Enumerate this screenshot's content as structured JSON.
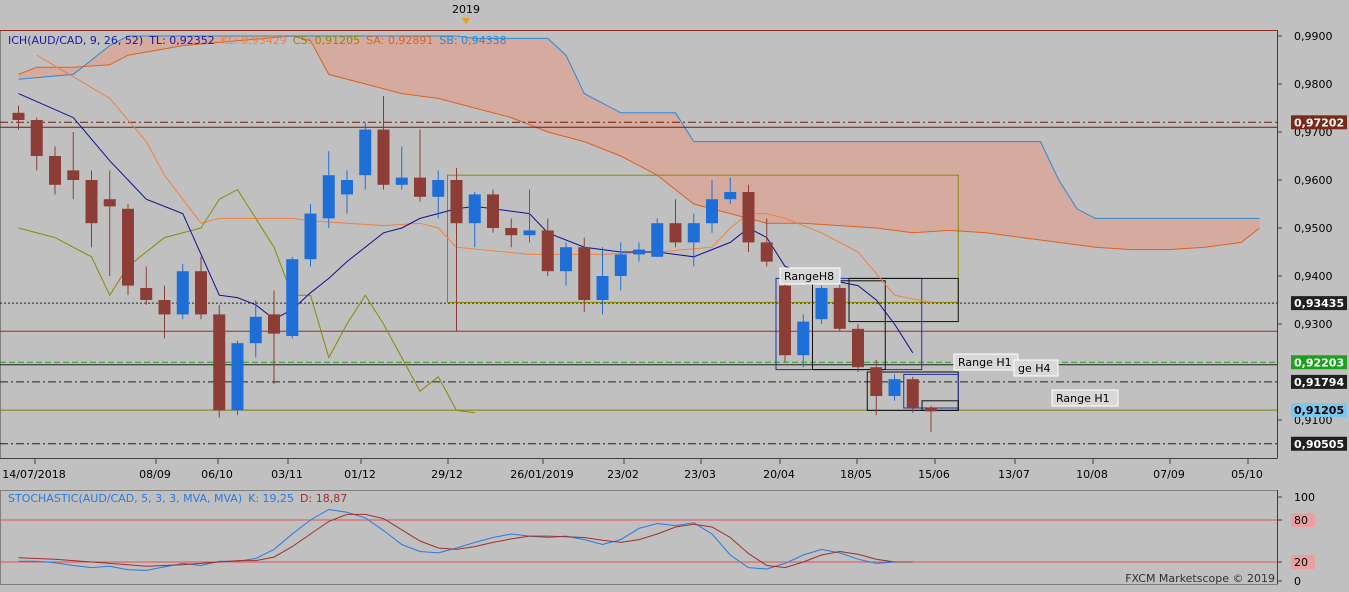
{
  "header": {
    "year_marker": "2019",
    "legend_ich": [
      {
        "text": "ICH(AUD/CAD, 9, 26, 52)",
        "color": "#1a1aa8"
      },
      {
        "text": "TL: 0,92352",
        "color": "#1a1aa8"
      },
      {
        "text": "KL: 0,93429",
        "color": "#f08040"
      },
      {
        "text": "CS: 0,91205",
        "color": "#8a8a00"
      },
      {
        "text": "SA: 0,92891",
        "color": "#e06020"
      },
      {
        "text": "SB: 0,94338",
        "color": "#2a8ad8"
      }
    ],
    "legend_stoch": [
      {
        "text": "STOCHASTIC(AUD/CAD, 5, 3, 3, MVA, MVA)",
        "color": "#2a7ae0"
      },
      {
        "text": "K: 19,25",
        "color": "#2a7ae0"
      },
      {
        "text": "D: 18,87",
        "color": "#a03030"
      }
    ],
    "watermark": "FXCM Marketscope © 2019"
  },
  "colors": {
    "bull": "#1e6ed8",
    "bear": "#8c3e36",
    "tenkan": "#101090",
    "kijun": "#f08040",
    "chikou": "#8a8a00",
    "senkou_a": "#e06020",
    "senkou_b": "#2a8ad8",
    "cloud": "#d6a89a",
    "stoch_k": "#2a7ae0",
    "stoch_d": "#a03030",
    "background": "#c0c0c0"
  },
  "chart_data": [
    {
      "type": "candlestick",
      "title": "AUD/CAD",
      "ylim": [
        0.9025,
        0.9925
      ],
      "y_ticks": [
        "0,9900",
        "0,9800",
        "0,9700",
        "0,9600",
        "0,9500",
        "0,9400",
        "0,9300",
        "0,9100"
      ],
      "x_ticks": [
        "14/07/2018",
        "08/09",
        "06/10",
        "03/11",
        "01/12",
        "29/12",
        "26/01/2019",
        "23/02",
        "23/03",
        "20/04",
        "18/05",
        "15/06",
        "13/07",
        "10/08",
        "07/09",
        "05/10"
      ],
      "price_tags": [
        {
          "text": "0,97202",
          "value": 0.97202,
          "bg": "#7a2a1a",
          "fg": "#ffffff"
        },
        {
          "text": "0,93435",
          "value": 0.93435,
          "bg": "#202020",
          "fg": "#ffffff"
        },
        {
          "text": "0,92203",
          "value": 0.92203,
          "bg": "#20a020",
          "fg": "#ffffff"
        },
        {
          "text": "0,91794",
          "value": 0.91794,
          "bg": "#202020",
          "fg": "#ffffff"
        },
        {
          "text": "0,91205",
          "value": 0.91205,
          "bg": "#7ac8f0",
          "fg": "#000000"
        },
        {
          "text": "0,90505",
          "value": 0.90505,
          "bg": "#202020",
          "fg": "#ffffff"
        }
      ],
      "candles": [
        [
          0.974,
          0.9755,
          0.9705,
          0.9725
        ],
        [
          0.9725,
          0.973,
          0.962,
          0.965
        ],
        [
          0.965,
          0.967,
          0.957,
          0.959
        ],
        [
          0.962,
          0.97,
          0.956,
          0.96
        ],
        [
          0.96,
          0.962,
          0.946,
          0.951
        ],
        [
          0.956,
          0.962,
          0.94,
          0.9545
        ],
        [
          0.954,
          0.955,
          0.936,
          0.938
        ],
        [
          0.9375,
          0.942,
          0.934,
          0.935
        ],
        [
          0.935,
          0.938,
          0.927,
          0.932
        ],
        [
          0.932,
          0.9425,
          0.931,
          0.941
        ],
        [
          0.941,
          0.944,
          0.931,
          0.932
        ],
        [
          0.932,
          0.934,
          0.9105,
          0.912
        ],
        [
          0.912,
          0.9265,
          0.911,
          0.926
        ],
        [
          0.926,
          0.935,
          0.923,
          0.9315
        ],
        [
          0.932,
          0.937,
          0.9175,
          0.928
        ],
        [
          0.9275,
          0.944,
          0.927,
          0.9435
        ],
        [
          0.9435,
          0.955,
          0.942,
          0.953
        ],
        [
          0.952,
          0.966,
          0.95,
          0.961
        ],
        [
          0.957,
          0.962,
          0.953,
          0.96
        ],
        [
          0.961,
          0.972,
          0.958,
          0.9705
        ],
        [
          0.9705,
          0.9775,
          0.958,
          0.959
        ],
        [
          0.959,
          0.967,
          0.958,
          0.9605
        ],
        [
          0.9605,
          0.9705,
          0.9555,
          0.9565
        ],
        [
          0.9565,
          0.962,
          0.952,
          0.96
        ],
        [
          0.96,
          0.9625,
          0.9285,
          0.951
        ],
        [
          0.951,
          0.9575,
          0.946,
          0.957
        ],
        [
          0.957,
          0.958,
          0.949,
          0.95
        ],
        [
          0.95,
          0.952,
          0.946,
          0.9485
        ],
        [
          0.9485,
          0.958,
          0.947,
          0.9495
        ],
        [
          0.9495,
          0.952,
          0.94,
          0.941
        ],
        [
          0.941,
          0.947,
          0.938,
          0.946
        ],
        [
          0.946,
          0.948,
          0.9325,
          0.935
        ],
        [
          0.935,
          0.946,
          0.932,
          0.94
        ],
        [
          0.94,
          0.947,
          0.937,
          0.9445
        ],
        [
          0.9445,
          0.947,
          0.943,
          0.9455
        ],
        [
          0.944,
          0.952,
          0.944,
          0.951
        ],
        [
          0.951,
          0.956,
          0.946,
          0.947
        ],
        [
          0.947,
          0.953,
          0.942,
          0.951
        ],
        [
          0.951,
          0.96,
          0.949,
          0.956
        ],
        [
          0.956,
          0.9605,
          0.955,
          0.9575
        ],
        [
          0.9575,
          0.959,
          0.945,
          0.947
        ],
        [
          0.947,
          0.952,
          0.942,
          0.943
        ],
        [
          0.938,
          0.9395,
          0.922,
          0.9235
        ],
        [
          0.9235,
          0.932,
          0.921,
          0.9305
        ],
        [
          0.931,
          0.938,
          0.93,
          0.9375
        ],
        [
          0.9375,
          0.9385,
          0.9285,
          0.929
        ],
        [
          0.929,
          0.93,
          0.92,
          0.921
        ],
        [
          0.921,
          0.9225,
          0.911,
          0.915
        ],
        [
          0.915,
          0.9195,
          0.914,
          0.9185
        ],
        [
          0.9185,
          0.919,
          0.9115,
          0.9125
        ],
        [
          0.9125,
          0.913,
          0.9075,
          0.9118
        ]
      ],
      "tenkan": [
        [
          0,
          0.978
        ],
        [
          3,
          0.973
        ],
        [
          5,
          0.964
        ],
        [
          7,
          0.956
        ],
        [
          9,
          0.953
        ],
        [
          11,
          0.936
        ],
        [
          12,
          0.9355
        ],
        [
          13,
          0.934
        ],
        [
          14,
          0.931
        ],
        [
          15,
          0.933
        ],
        [
          16,
          0.9365
        ],
        [
          17,
          0.9395
        ],
        [
          18,
          0.943
        ],
        [
          20,
          0.949
        ],
        [
          21,
          0.95
        ],
        [
          22,
          0.952
        ],
        [
          24,
          0.954
        ],
        [
          25,
          0.9545
        ],
        [
          28,
          0.953
        ],
        [
          29,
          0.949
        ],
        [
          31,
          0.946
        ],
        [
          33,
          0.945
        ],
        [
          35,
          0.945
        ],
        [
          37,
          0.944
        ],
        [
          38,
          0.9455
        ],
        [
          39,
          0.947
        ],
        [
          40,
          0.95
        ],
        [
          41,
          0.948
        ],
        [
          42,
          0.942
        ],
        [
          44,
          0.9395
        ],
        [
          46,
          0.938
        ],
        [
          47,
          0.935
        ],
        [
          48,
          0.93
        ],
        [
          49,
          0.924
        ]
      ],
      "kijun": [
        [
          1,
          0.986
        ],
        [
          5,
          0.977
        ],
        [
          7,
          0.968
        ],
        [
          8,
          0.961
        ],
        [
          9,
          0.956
        ],
        [
          10,
          0.951
        ],
        [
          11,
          0.952
        ],
        [
          14,
          0.952
        ],
        [
          15,
          0.952
        ],
        [
          16,
          0.9515
        ],
        [
          18,
          0.951
        ],
        [
          20,
          0.9505
        ],
        [
          22,
          0.951
        ],
        [
          23,
          0.95
        ],
        [
          24,
          0.946
        ],
        [
          28,
          0.9445
        ],
        [
          32,
          0.9445
        ],
        [
          35,
          0.945
        ],
        [
          38,
          0.946
        ],
        [
          39,
          0.95
        ],
        [
          40,
          0.953
        ],
        [
          41,
          0.953
        ],
        [
          42,
          0.952
        ],
        [
          44,
          0.949
        ],
        [
          46,
          0.945
        ],
        [
          48,
          0.936
        ],
        [
          50,
          0.9345
        ]
      ],
      "chikou": [
        [
          0,
          0.95
        ],
        [
          2,
          0.948
        ],
        [
          4,
          0.944
        ],
        [
          5,
          0.936
        ],
        [
          6,
          0.942
        ],
        [
          8,
          0.948
        ],
        [
          10,
          0.95
        ],
        [
          11,
          0.956
        ],
        [
          12,
          0.958
        ],
        [
          14,
          0.946
        ],
        [
          15,
          0.936
        ],
        [
          16,
          0.936
        ],
        [
          17,
          0.923
        ],
        [
          18,
          0.93
        ],
        [
          19,
          0.936
        ],
        [
          20,
          0.93
        ],
        [
          21,
          0.923
        ],
        [
          22,
          0.916
        ],
        [
          23,
          0.919
        ],
        [
          24,
          0.912
        ],
        [
          25,
          0.9115
        ]
      ],
      "senkou_a": [
        [
          0,
          0.982
        ],
        [
          1,
          0.9835
        ],
        [
          3,
          0.9835
        ],
        [
          5,
          0.984
        ],
        [
          6,
          0.986
        ],
        [
          9,
          0.988
        ],
        [
          12,
          0.989
        ],
        [
          15,
          0.99
        ],
        [
          16,
          0.989
        ],
        [
          17,
          0.982
        ],
        [
          19,
          0.98
        ],
        [
          21,
          0.978
        ],
        [
          23,
          0.977
        ],
        [
          25,
          0.975
        ],
        [
          27,
          0.973
        ],
        [
          29,
          0.97
        ],
        [
          31,
          0.968
        ],
        [
          33,
          0.965
        ],
        [
          35,
          0.961
        ],
        [
          36,
          0.958
        ],
        [
          37,
          0.955
        ],
        [
          39,
          0.953
        ],
        [
          41,
          0.951
        ],
        [
          43,
          0.951
        ],
        [
          45,
          0.9505
        ],
        [
          47,
          0.95
        ],
        [
          49,
          0.949
        ],
        [
          51,
          0.9495
        ],
        [
          53,
          0.949
        ],
        [
          55,
          0.948
        ],
        [
          57,
          0.947
        ],
        [
          59,
          0.946
        ],
        [
          61,
          0.9455
        ],
        [
          63,
          0.9455
        ],
        [
          65,
          0.946
        ],
        [
          67,
          0.947
        ],
        [
          68,
          0.95
        ]
      ],
      "senkou_b": [
        [
          0,
          0.981
        ],
        [
          3,
          0.982
        ],
        [
          5,
          0.988
        ],
        [
          6,
          0.99
        ],
        [
          24,
          0.99
        ],
        [
          25,
          0.9895
        ],
        [
          29,
          0.9895
        ],
        [
          30,
          0.986
        ],
        [
          31,
          0.978
        ],
        [
          32,
          0.976
        ],
        [
          33,
          0.974
        ],
        [
          36,
          0.974
        ],
        [
          37,
          0.968
        ],
        [
          56,
          0.968
        ],
        [
          57,
          0.96
        ],
        [
          58,
          0.954
        ],
        [
          59,
          0.952
        ],
        [
          65,
          0.952
        ],
        [
          68,
          0.952
        ]
      ],
      "horizontal_lines": [
        {
          "value": 0.97202,
          "color": "#6a2010",
          "style": "dashdot"
        },
        {
          "value": 0.971,
          "color": "#6a2010",
          "style": "solid"
        },
        {
          "value": 0.93435,
          "color": "#202020",
          "style": "dotted"
        },
        {
          "value": 0.9285,
          "color": "#a03020",
          "style": "solid"
        },
        {
          "value": 0.92203,
          "color": "#20a020",
          "style": "dashed"
        },
        {
          "value": 0.9215,
          "color": "#202020",
          "style": "solid"
        },
        {
          "value": 0.91794,
          "color": "#202020",
          "style": "dashdot"
        },
        {
          "value": 0.91205,
          "color": "#808000",
          "style": "solid"
        },
        {
          "value": 0.90505,
          "color": "#202020",
          "style": "dashdot"
        }
      ],
      "range_boxes": [
        {
          "x0": 24,
          "x1": 51,
          "y0": 0.9345,
          "y1": 0.961,
          "color": "#8a8a00",
          "label": ""
        },
        {
          "x0": 42,
          "x1": 49,
          "y0": 0.9205,
          "y1": 0.9395,
          "color": "#2030a0",
          "label": "RangeH8"
        },
        {
          "x0": 44,
          "x1": 47,
          "y0": 0.9205,
          "y1": 0.939,
          "color": "#101010",
          "label": ""
        },
        {
          "x0": 46,
          "x1": 51,
          "y0": 0.9305,
          "y1": 0.9395,
          "color": "#101010",
          "label": ""
        },
        {
          "x0": 47,
          "x1": 51,
          "y0": 0.912,
          "y1": 0.92,
          "color": "#101010",
          "label": "Range H1"
        },
        {
          "x0": 49,
          "x1": 51,
          "y0": 0.9125,
          "y1": 0.9195,
          "color": "#2030a0",
          "label": "ge H4"
        },
        {
          "x0": 50,
          "x1": 51,
          "y0": 0.912,
          "y1": 0.914,
          "color": "#101010",
          "label": ""
        }
      ],
      "floating_labels": [
        "RangeH8",
        "Range H1",
        "ge H4",
        "Range H1"
      ]
    },
    {
      "type": "line",
      "title": "STOCHASTIC(AUD/CAD, 5, 3, 3, MVA, MVA)",
      "ylim": [
        0,
        100
      ],
      "y_ticks": [
        "100",
        "80",
        "20",
        "0"
      ],
      "levels": [
        80,
        20
      ],
      "series": [
        {
          "name": "K",
          "values": [
            21,
            21,
            19,
            15,
            12,
            14,
            9,
            8,
            13,
            18,
            15,
            21,
            21,
            25,
            38,
            60,
            80,
            95,
            91,
            83,
            65,
            45,
            35,
            33,
            40,
            48,
            55,
            60,
            57,
            55,
            57,
            52,
            45,
            52,
            68,
            75,
            72,
            76,
            60,
            30,
            12,
            10,
            18,
            30,
            38,
            33,
            24,
            18,
            20,
            20
          ]
        },
        {
          "name": "D",
          "values": [
            26,
            25,
            24,
            22,
            20,
            18,
            16,
            14,
            15,
            16,
            18,
            20,
            22,
            22,
            27,
            42,
            60,
            78,
            88,
            88,
            82,
            66,
            50,
            40,
            38,
            42,
            48,
            53,
            57,
            57,
            56,
            55,
            51,
            48,
            52,
            60,
            70,
            74,
            70,
            55,
            32,
            15,
            12,
            20,
            30,
            35,
            31,
            24,
            20,
            20
          ]
        }
      ]
    }
  ]
}
